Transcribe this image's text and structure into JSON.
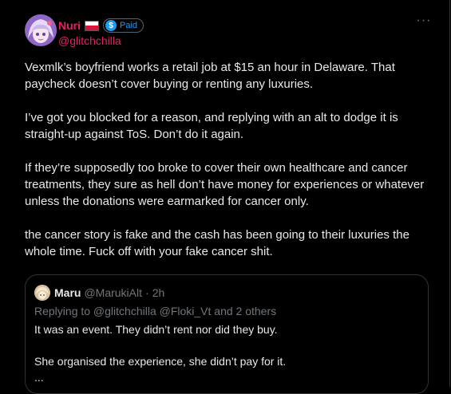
{
  "post": {
    "author": {
      "display_name": "Nuri",
      "flag_icon": "poland-flag-icon",
      "badge_label": "Paid",
      "handle": "@glitchchilla"
    },
    "more_label": "···",
    "paragraphs": [
      "Vexmlk’s boyfriend works a retail job at $15 an hour in Delaware. That paycheck doesn’t cover buying or renting any luxuries.",
      "I’ve got you blocked for a reason, and replying with an alt to dodge it is straight-up against ToS. Don’t do it again.",
      "If they’re supposedly too broke to cover their own healthcare and cancer treatments, they sure as hell don’t have money for experiences or whatever unless the donations were earmarked for cancer only.",
      "the cancer story is fake and the cash has been going to their luxuries the whole time. Fuck off with your fake cancer shit."
    ]
  },
  "quote": {
    "name": "Maru",
    "handle": "@MarukiAlt",
    "separator": "·",
    "time": "2h",
    "replying_to": "Replying to @glitchchilla @Floki_Vt and 2 others",
    "lines": [
      "It was an event. They didn’t rent nor did they buy.",
      "She organised the experience, she didn’t pay for it.",
      "..."
    ]
  },
  "colors": {
    "background": "#000000",
    "text": "#e7e9ea",
    "muted": "#71767b",
    "accent_name": "#e0245e",
    "paid_blue": "#1d9bf0",
    "border": "#2f3336"
  }
}
